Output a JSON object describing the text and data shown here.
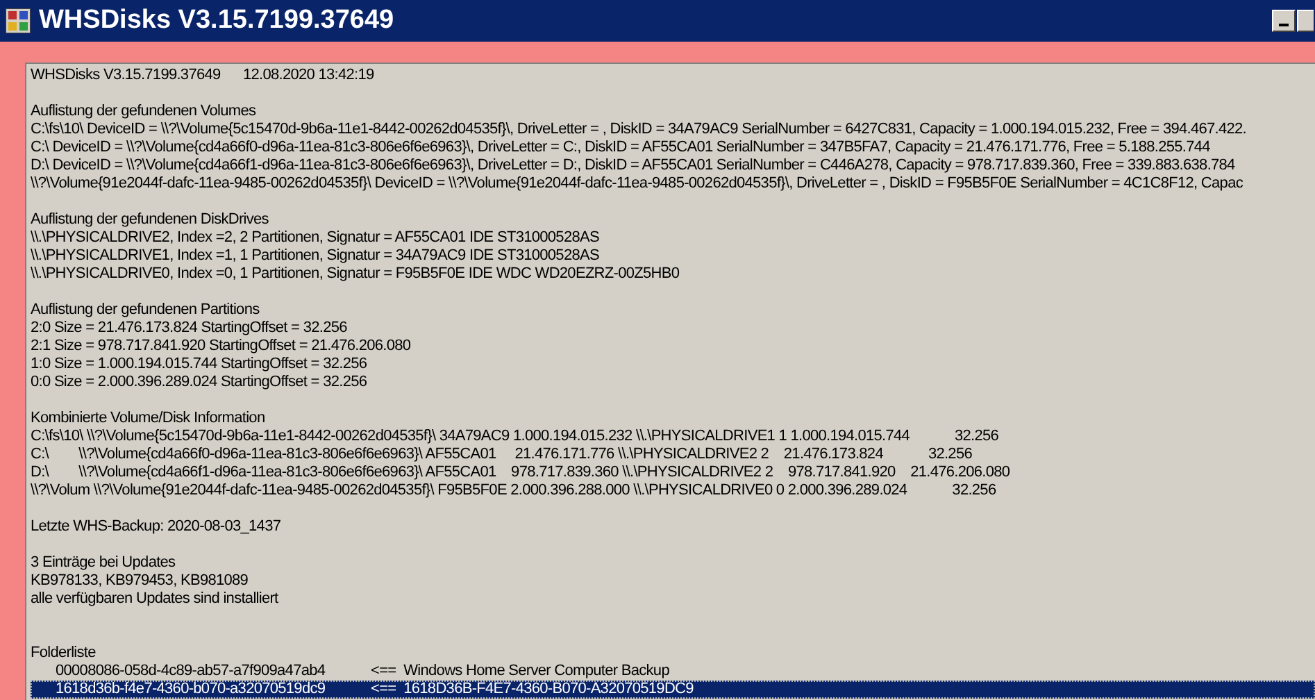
{
  "window": {
    "title": "WHSDisks V3.15.7199.37649"
  },
  "header": {
    "app": "WHSDisks V3.15.7199.37649",
    "timestamp": "12.08.2020 13:42:19"
  },
  "sections": [
    {
      "kind": "text",
      "heading": "Auflistung der gefundenen Volumes",
      "lines": [
        "C:\\fs\\10\\ DeviceID = \\\\?\\Volume{5c15470d-9b6a-11e1-8442-00262d04535f}\\, DriveLetter = , DiskID = 34A79AC9 SerialNumber = 6427C831, Capacity = 1.000.194.015.232, Free = 394.467.422.",
        "C:\\ DeviceID = \\\\?\\Volume{cd4a66f0-d96a-11ea-81c3-806e6f6e6963}\\, DriveLetter = C:, DiskID = AF55CA01 SerialNumber = 347B5FA7, Capacity = 21.476.171.776, Free = 5.188.255.744",
        "D:\\ DeviceID = \\\\?\\Volume{cd4a66f1-d96a-11ea-81c3-806e6f6e6963}\\, DriveLetter = D:, DiskID = AF55CA01 SerialNumber = C446A278, Capacity = 978.717.839.360, Free = 339.883.638.784",
        "\\\\?\\Volume{91e2044f-dafc-11ea-9485-00262d04535f}\\ DeviceID = \\\\?\\Volume{91e2044f-dafc-11ea-9485-00262d04535f}\\, DriveLetter = , DiskID = F95B5F0E SerialNumber = 4C1C8F12, Capac"
      ]
    },
    {
      "kind": "text",
      "heading": "Auflistung der gefundenen DiskDrives",
      "lines": [
        "\\\\.\\PHYSICALDRIVE2, Index =2, 2 Partitionen, Signatur = AF55CA01 IDE ST31000528AS",
        "\\\\.\\PHYSICALDRIVE1, Index =1, 1 Partitionen, Signatur = 34A79AC9 IDE ST31000528AS",
        "\\\\.\\PHYSICALDRIVE0, Index =0, 1 Partitionen, Signatur = F95B5F0E IDE WDC WD20EZRZ-00Z5HB0"
      ]
    },
    {
      "kind": "text",
      "heading": "Auflistung der gefundenen Partitions",
      "lines": [
        "2:0 Size = 21.476.173.824 StartingOffset = 32.256",
        "2:1 Size = 978.717.841.920 StartingOffset = 21.476.206.080",
        "1:0 Size = 1.000.194.015.744 StartingOffset = 32.256",
        "0:0 Size = 2.000.396.289.024 StartingOffset = 32.256"
      ]
    },
    {
      "kind": "text",
      "heading": "Kombinierte Volume/Disk Information",
      "lines": [
        "C:\\fs\\10\\ \\\\?\\Volume{5c15470d-9b6a-11e1-8442-00262d04535f}\\ 34A79AC9 1.000.194.015.232 \\\\.\\PHYSICALDRIVE1 1 1.000.194.015.744            32.256",
        "C:\\        \\\\?\\Volume{cd4a66f0-d96a-11ea-81c3-806e6f6e6963}\\ AF55CA01     21.476.171.776 \\\\.\\PHYSICALDRIVE2 2    21.476.173.824            32.256",
        "D:\\        \\\\?\\Volume{cd4a66f1-d96a-11ea-81c3-806e6f6e6963}\\ AF55CA01    978.717.839.360 \\\\.\\PHYSICALDRIVE2 2    978.717.841.920    21.476.206.080",
        "\\\\?\\Volum \\\\?\\Volume{91e2044f-dafc-11ea-9485-00262d04535f}\\ F95B5F0E 2.000.396.288.000 \\\\.\\PHYSICALDRIVE0 0 2.000.396.289.024            32.256"
      ]
    },
    {
      "kind": "text",
      "lines": [
        "Letzte WHS-Backup: 2020-08-03_1437"
      ]
    },
    {
      "kind": "text",
      "lines": [
        "3 Einträge bei Updates",
        "KB978133, KB979453, KB981089",
        "alle verfügbaren Updates sind installiert"
      ]
    },
    {
      "kind": "folders",
      "heading": "Folderliste",
      "items": [
        {
          "id": "00008086-058d-4c89-ab57-a7f909a47ab4",
          "arrow": "<==",
          "target": "Windows Home Server Computer Backup",
          "selected": false
        },
        {
          "id": "1618d36b-f4e7-4360-b070-a32070519dc9",
          "arrow": "<==",
          "target": "1618D36B-F4E7-4360-B070-A32070519DC9",
          "selected": true
        }
      ]
    }
  ]
}
